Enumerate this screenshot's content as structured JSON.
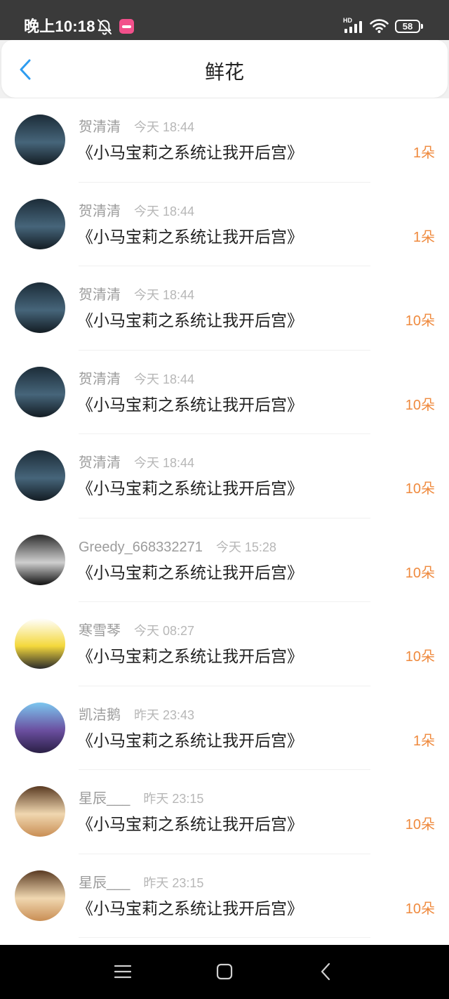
{
  "status_bar": {
    "time": "晚上10:18",
    "hd_label": "HD",
    "battery": "58",
    "icons": [
      "mute-icon",
      "app-notification-icon",
      "signal-icon",
      "wifi-icon",
      "battery-icon"
    ]
  },
  "header": {
    "back_icon": "chevron-left-icon",
    "title": "鲜花"
  },
  "colors": {
    "status_bar_bg": "#3a3a3a",
    "accent_blue": "#2d9cf0",
    "flower_orange": "#ef8a3e",
    "nav_bar_bg": "#000000"
  },
  "flower_list": {
    "items": [
      {
        "user": "贺清清",
        "time": "今天 18:44",
        "title": "《小马宝莉之系统让我开后宫》",
        "count": "1朵",
        "avatar_colors": [
          "#1c2c38",
          "#46657a",
          "#131c23"
        ]
      },
      {
        "user": "贺清清",
        "time": "今天 18:44",
        "title": "《小马宝莉之系统让我开后宫》",
        "count": "1朵",
        "avatar_colors": [
          "#1c2c38",
          "#46657a",
          "#131c23"
        ]
      },
      {
        "user": "贺清清",
        "time": "今天 18:44",
        "title": "《小马宝莉之系统让我开后宫》",
        "count": "10朵",
        "avatar_colors": [
          "#1c2c38",
          "#46657a",
          "#131c23"
        ]
      },
      {
        "user": "贺清清",
        "time": "今天 18:44",
        "title": "《小马宝莉之系统让我开后宫》",
        "count": "10朵",
        "avatar_colors": [
          "#1c2c38",
          "#46657a",
          "#131c23"
        ]
      },
      {
        "user": "贺清清",
        "time": "今天 18:44",
        "title": "《小马宝莉之系统让我开后宫》",
        "count": "10朵",
        "avatar_colors": [
          "#1c2c38",
          "#46657a",
          "#131c23"
        ]
      },
      {
        "user": "Greedy_668332271",
        "time": "今天 15:28",
        "title": "《小马宝莉之系统让我开后宫》",
        "count": "10朵",
        "avatar_colors": [
          "#2e2e2e",
          "#cfcfcf",
          "#101010"
        ]
      },
      {
        "user": "寒雪琴",
        "time": "今天 08:27",
        "title": "《小马宝莉之系统让我开后宫》",
        "count": "10朵",
        "avatar_colors": [
          "#ffffff",
          "#f4d83c",
          "#2b2b2b"
        ]
      },
      {
        "user": "凯洁鹅",
        "time": "昨天 23:43",
        "title": "《小马宝莉之系统让我开后宫》",
        "count": "1朵",
        "avatar_colors": [
          "#7cc6ef",
          "#6b4fa0",
          "#2a1f45"
        ]
      },
      {
        "user": "星辰___",
        "time": "昨天 23:15",
        "title": "《小马宝莉之系统让我开后宫》",
        "count": "10朵",
        "avatar_colors": [
          "#5a3a22",
          "#f0d7b0",
          "#c98e54"
        ]
      },
      {
        "user": "星辰___",
        "time": "昨天 23:15",
        "title": "《小马宝莉之系统让我开后宫》",
        "count": "10朵",
        "avatar_colors": [
          "#5a3a22",
          "#f0d7b0",
          "#c98e54"
        ]
      }
    ]
  },
  "nav_bar": {
    "icons": [
      "menu-icon",
      "home-icon",
      "back-icon"
    ]
  }
}
